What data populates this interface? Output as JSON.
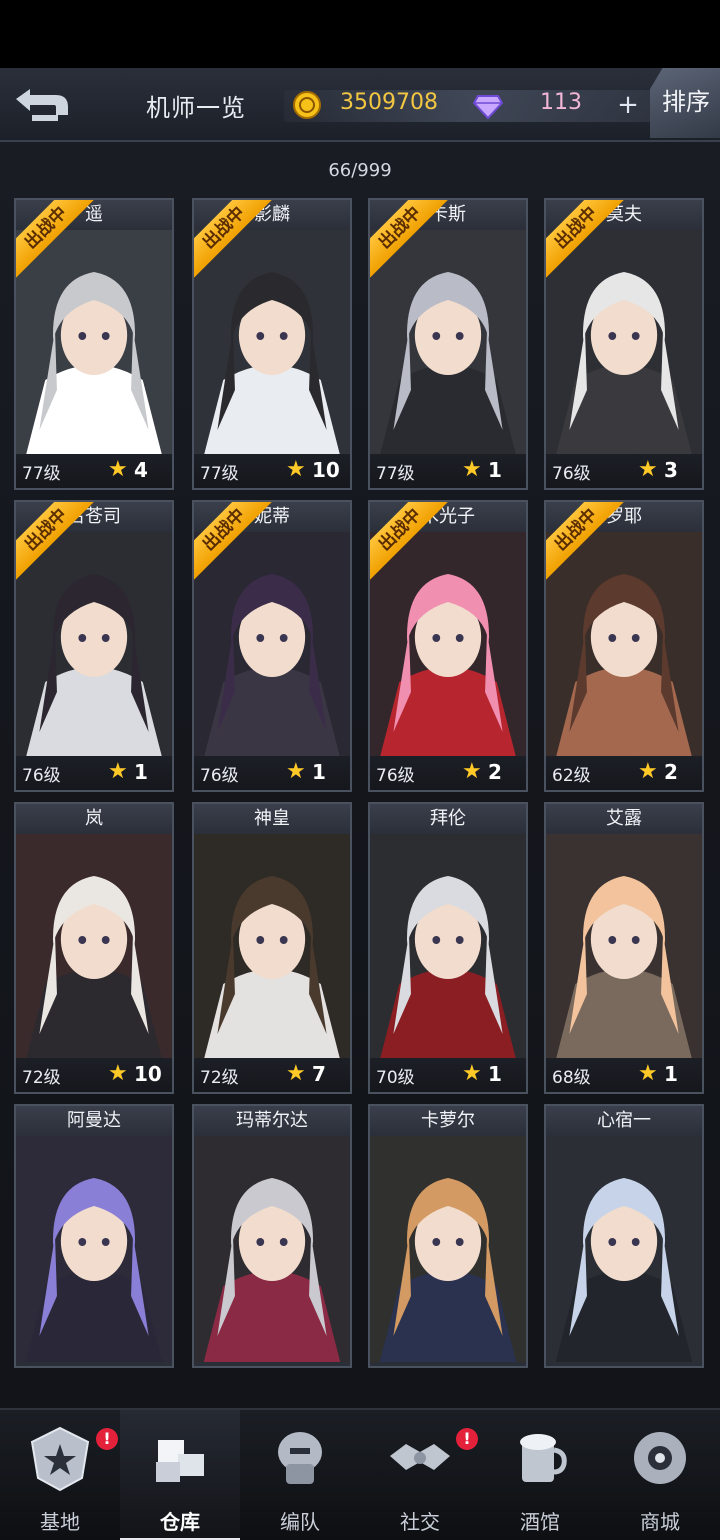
{
  "header": {
    "title": "机师一览",
    "coins": "3509708",
    "gems": "113",
    "plus_label": "+",
    "sort_label": "排序"
  },
  "count": "66/999",
  "cards": [
    {
      "name": "遥",
      "level": "77级",
      "stars": "4",
      "badge": "出战中",
      "hair": "#c7c9cc",
      "cloth": "#ffffff",
      "bg": "#3a3e45"
    },
    {
      "name": "影麟",
      "level": "77级",
      "stars": "10",
      "badge": "出战中",
      "hair": "#2a2a2e",
      "cloth": "#e9edf2",
      "bg": "#2f3238"
    },
    {
      "name": "卡斯",
      "level": "77级",
      "stars": "1",
      "badge": "出战中",
      "hair": "#b9bcc6",
      "cloth": "#2a2b30",
      "bg": "#34363c"
    },
    {
      "name": "莫夫",
      "level": "76级",
      "stars": "3",
      "badge": "出战中",
      "hair": "#e6e6e6",
      "cloth": "#3a3a3e",
      "bg": "#2d2f34"
    },
    {
      "name": "名苍司",
      "level": "76级",
      "stars": "1",
      "badge": "出战中",
      "hair": "#2b2630",
      "cloth": "#d9dbe0",
      "bg": "#2b2d33"
    },
    {
      "name": "妮蒂",
      "level": "76级",
      "stars": "1",
      "badge": "出战中",
      "hair": "#3b2d4a",
      "cloth": "#3a3644",
      "bg": "#2a2832"
    },
    {
      "name": "木光子",
      "level": "76级",
      "stars": "2",
      "badge": "出战中",
      "hair": "#f08fb0",
      "cloth": "#b7262e",
      "bg": "#34272b"
    },
    {
      "name": "罗耶",
      "level": "62级",
      "stars": "2",
      "badge": "出战中",
      "hair": "#5c3a2e",
      "cloth": "#a4684e",
      "bg": "#3a2e2a"
    },
    {
      "name": "岚",
      "level": "72级",
      "stars": "10",
      "badge": "",
      "hair": "#eae7e2",
      "cloth": "#2c2a2e",
      "bg": "#3b2a2c"
    },
    {
      "name": "神皇",
      "level": "72级",
      "stars": "7",
      "badge": "",
      "hair": "#4a3a2e",
      "cloth": "#e4e2e0",
      "bg": "#2e2a26"
    },
    {
      "name": "拜伦",
      "level": "70级",
      "stars": "1",
      "badge": "",
      "hair": "#d9dbe0",
      "cloth": "#8a1e22",
      "bg": "#2b2d31"
    },
    {
      "name": "艾露",
      "level": "68级",
      "stars": "1",
      "badge": "",
      "hair": "#f2c39c",
      "cloth": "#7a6a5e",
      "bg": "#3a3230"
    },
    {
      "name": "阿曼达",
      "level": "",
      "stars": "",
      "badge": "",
      "hair": "#8a7fd6",
      "cloth": "#2a2838",
      "bg": "#2d2b3a"
    },
    {
      "name": "玛蒂尔达",
      "level": "",
      "stars": "",
      "badge": "",
      "hair": "#c9c9cf",
      "cloth": "#8a2a44",
      "bg": "#2e2c30"
    },
    {
      "name": "卡萝尔",
      "level": "",
      "stars": "",
      "badge": "",
      "hair": "#d39a63",
      "cloth": "#2a3250",
      "bg": "#30302e"
    },
    {
      "name": "心宿一",
      "level": "",
      "stars": "",
      "badge": "",
      "hair": "#c6d3e8",
      "cloth": "#22252b",
      "bg": "#2b2e35"
    }
  ],
  "nav": [
    {
      "label": "基地",
      "icon": "base-icon",
      "alert": "!"
    },
    {
      "label": "仓库",
      "icon": "warehouse-icon",
      "alert": ""
    },
    {
      "label": "编队",
      "icon": "formation-icon",
      "alert": ""
    },
    {
      "label": "社交",
      "icon": "handshake-icon",
      "alert": "!"
    },
    {
      "label": "酒馆",
      "icon": "tavern-icon",
      "alert": ""
    },
    {
      "label": "商城",
      "icon": "shop-icon",
      "alert": ""
    }
  ],
  "colors": {
    "coin": "#f3c742",
    "gem": "#f2b7d6",
    "badge": "#ffc43a",
    "alert": "#e3213a"
  }
}
